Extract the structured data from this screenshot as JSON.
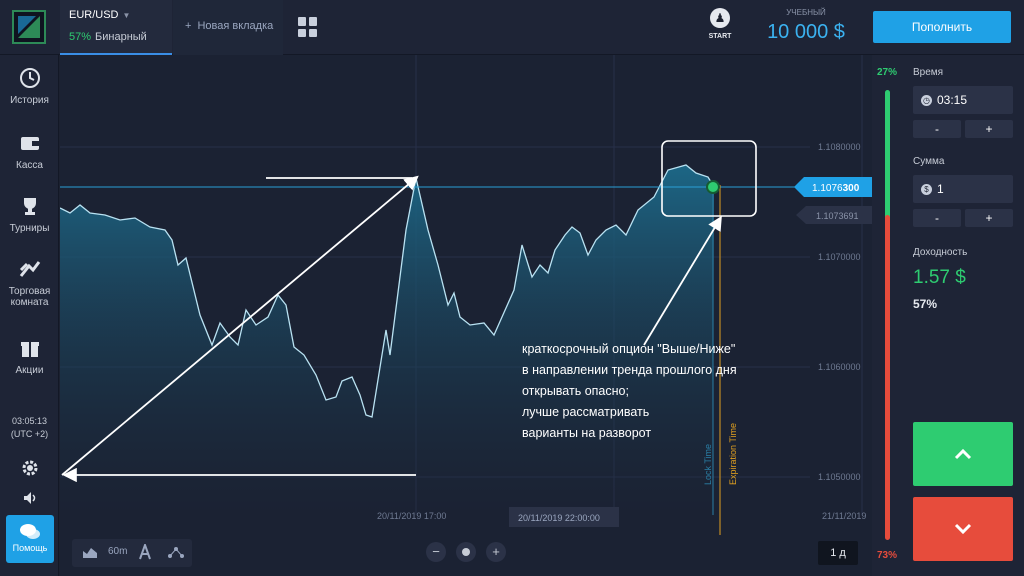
{
  "topbar": {
    "asset": "EUR/USD",
    "payout_pct": "57%",
    "option_type": "Бинарный",
    "new_tab_label": "Новая вкладка",
    "start_label": "START",
    "balance_label": "УЧЕБНЫЙ",
    "balance_amount": "10 000 $",
    "deposit_label": "Пополнить"
  },
  "sidebar": {
    "items": [
      {
        "label": "История",
        "icon": "history-icon"
      },
      {
        "label": "Касса",
        "icon": "wallet-icon"
      },
      {
        "label": "Турниры",
        "icon": "trophy-icon"
      },
      {
        "label": "Торговая комната",
        "icon": "trading-room-icon"
      },
      {
        "label": "Акции",
        "icon": "gift-icon"
      }
    ],
    "time": "03:05:13",
    "timezone": "(UTC +2)",
    "help_label": "Помощь"
  },
  "chart": {
    "price_labels": [
      "1.1080000",
      "1.1070000",
      "1.1060000",
      "1.1050000"
    ],
    "current_price_prefix": "1.1076",
    "current_price_suffix": "300",
    "secondary_price": "1.1073691",
    "time_labels": [
      "20/11/2019 17:00",
      "20/11/2019 22:00:00",
      "21/11/2019"
    ],
    "lock_time_label": "Lock Time",
    "expiration_label": "Expiration Time",
    "annotation_lines": [
      "краткосрочный опцион \"Выше/Ниже\"",
      "в направлении тренда прошлого дня",
      "открывать опасно;",
      "лучше рассматривать",
      "варианты на разворот"
    ],
    "timeframe_label": "60m",
    "period_label": "1 д"
  },
  "strip": {
    "up_pct": "27%",
    "down_pct": "73%"
  },
  "panel": {
    "time_label": "Время",
    "time_value": "03:15",
    "amount_label": "Сумма",
    "amount_value": "1",
    "profit_label": "Доходность",
    "profit_amount": "1.57 $",
    "profit_pct": "57%",
    "minus": "-",
    "plus": "+"
  },
  "colors": {
    "accent": "#1fa1e6",
    "up": "#2ecc71",
    "down": "#e74c3c",
    "background": "#1c2130"
  }
}
